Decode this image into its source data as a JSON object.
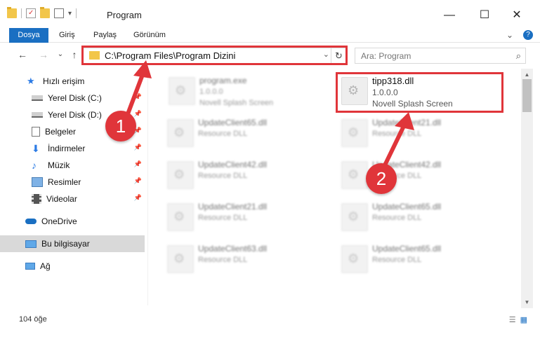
{
  "window": {
    "title": "Program"
  },
  "window_controls": {
    "minimize": "—",
    "maximize": "☐",
    "close": "✕"
  },
  "ribbon": {
    "tabs": [
      "Dosya",
      "Giriş",
      "Paylaş",
      "Görünüm"
    ],
    "right_icons": [
      "chevron-down-icon",
      "help-icon"
    ],
    "right_glyphs": [
      "⌄",
      "?"
    ]
  },
  "nav": {
    "back": "←",
    "forward": "→",
    "recent": "⌄",
    "up": "↑"
  },
  "address": {
    "path": "C:\\Program Files\\Program Dizini",
    "dropdown": "⌄",
    "refresh": "↻"
  },
  "search": {
    "placeholder": "Ara: Program",
    "icon": "⌕"
  },
  "sidebar": {
    "items": [
      {
        "label": "Hızlı erişim",
        "icon": "star-icon",
        "pinned": false
      },
      {
        "label": "Yerel Disk (C:)",
        "icon": "drive-icon",
        "pinned": true
      },
      {
        "label": "Yerel Disk (D:)",
        "icon": "drive-icon",
        "pinned": true
      },
      {
        "label": "Belgeler",
        "icon": "documents-icon",
        "pinned": true
      },
      {
        "label": "İndirmeler",
        "icon": "download-icon",
        "pinned": true
      },
      {
        "label": "Müzik",
        "icon": "music-icon",
        "pinned": true
      },
      {
        "label": "Resimler",
        "icon": "pictures-icon",
        "pinned": true
      },
      {
        "label": "Videolar",
        "icon": "videos-icon",
        "pinned": true
      },
      {
        "label": "OneDrive",
        "icon": "cloud-icon",
        "pinned": false
      },
      {
        "label": "Bu bilgisayar",
        "icon": "computer-icon",
        "pinned": false,
        "selected": true
      },
      {
        "label": "Ağ",
        "icon": "network-icon",
        "pinned": false
      }
    ]
  },
  "files": {
    "col1": [
      {
        "name": "program.exe",
        "line1": "1.0.0.0",
        "line2": "Novell Splash Screen"
      },
      {
        "name": "UpdateClient65.dll",
        "line1": "Resource DLL",
        "line2": ""
      },
      {
        "name": "UpdateClient42.dll",
        "line1": "Resource DLL",
        "line2": ""
      },
      {
        "name": "UpdateClient21.dll",
        "line1": "Resource DLL",
        "line2": ""
      },
      {
        "name": "UpdateClient63.dll",
        "line1": "Resource DLL",
        "line2": ""
      }
    ],
    "col2": [
      {
        "name": "tipp318.dll",
        "line1": "1.0.0.0",
        "line2": "Novell Splash Screen"
      },
      {
        "name": "UpdateClient21.dll",
        "line1": "Resource DLL",
        "line2": ""
      },
      {
        "name": "UpdateClient42.dll",
        "line1": "Resource DLL",
        "line2": ""
      },
      {
        "name": "UpdateClient65.dll",
        "line1": "Resource DLL",
        "line2": ""
      },
      {
        "name": "UpdateClient65.dll",
        "line1": "Resource DLL",
        "line2": ""
      }
    ]
  },
  "annotations": {
    "badge1": "1",
    "badge2": "2",
    "color": "#e0353a"
  },
  "status": {
    "item_count": "104 öğe"
  },
  "view_buttons": {
    "details": "☰",
    "tiles": "▦"
  },
  "scroll": {
    "up": "▲",
    "down": "▼"
  },
  "colors": {
    "file_tab": "#1a6fc2",
    "selected_nav": "#d9d9d9",
    "folder": "#f2c64a"
  }
}
